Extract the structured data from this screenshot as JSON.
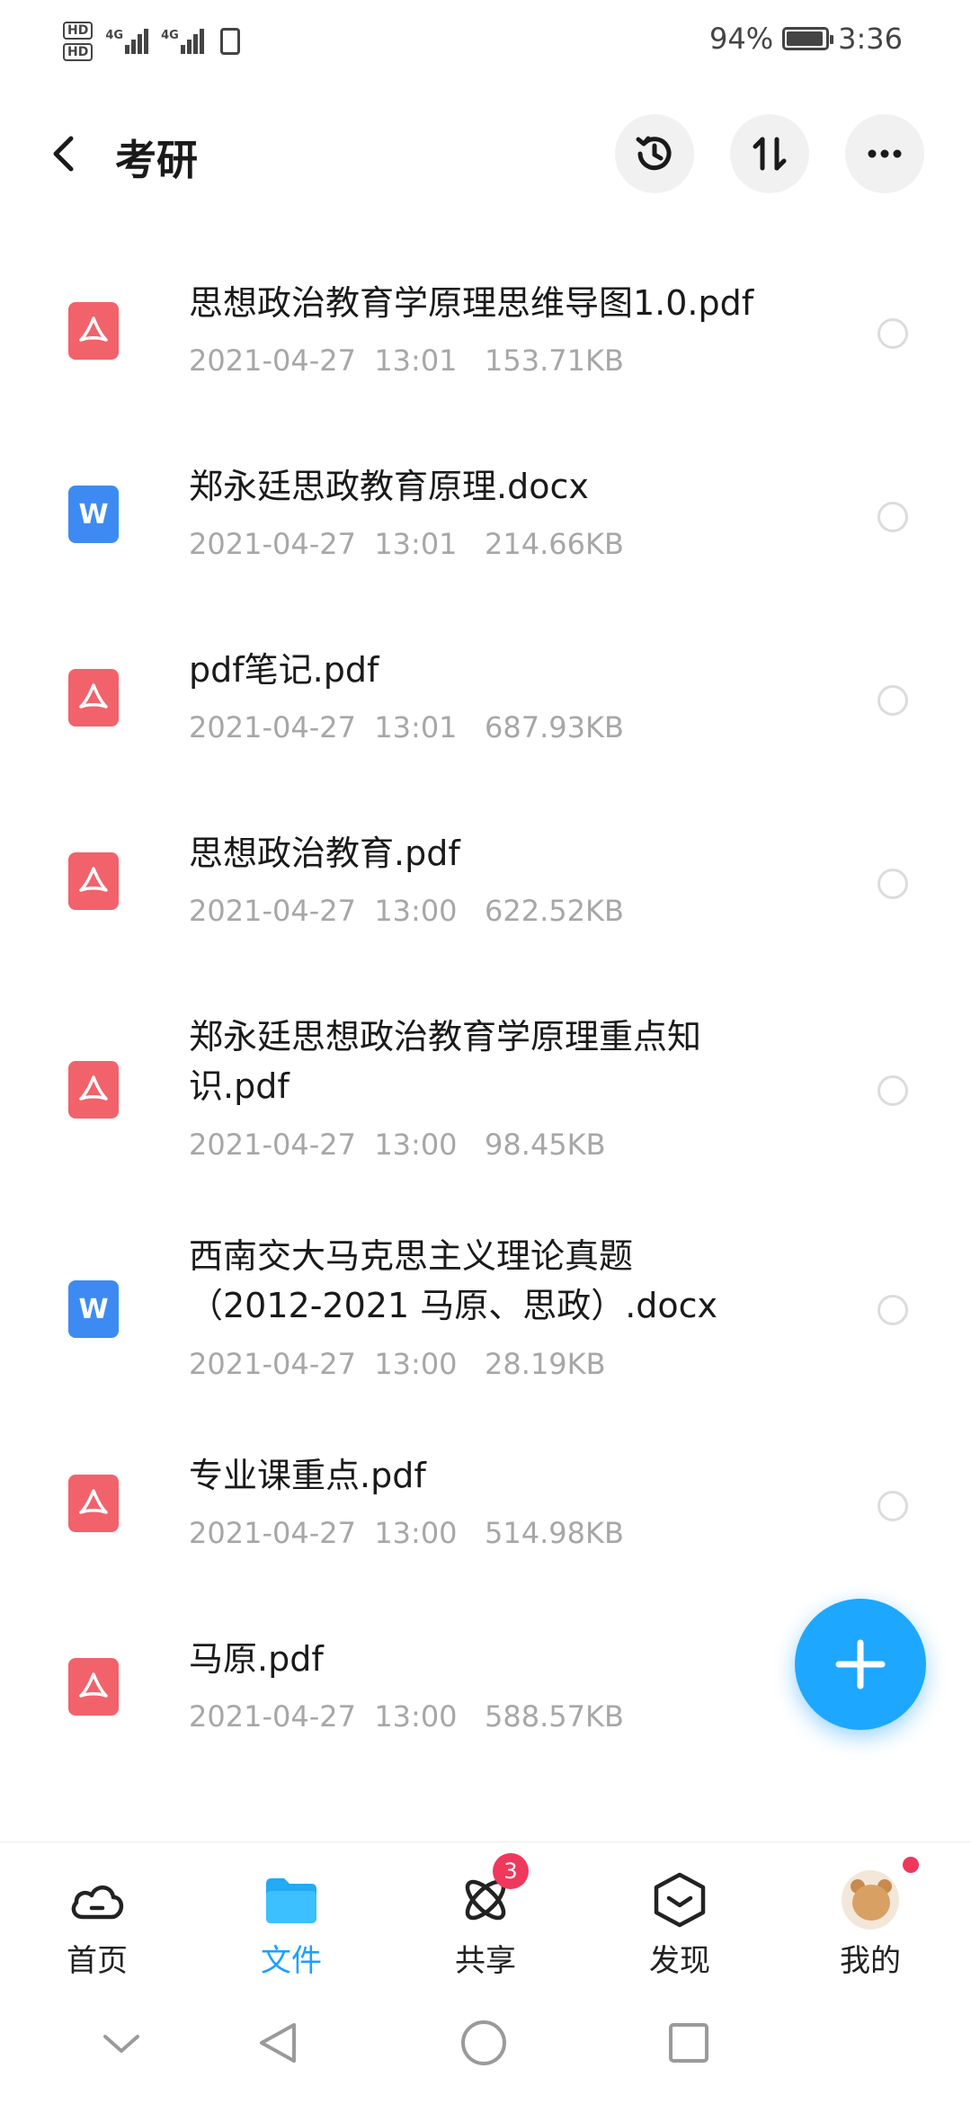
{
  "status_bar": {
    "hd1": "HD",
    "hd2": "HD",
    "net1": "4G",
    "net2": "4G",
    "battery_percent": "94%",
    "battery_level": 0.94,
    "time": "3:36"
  },
  "header": {
    "title": "考研",
    "back_icon": "chevron-left-icon",
    "history_icon": "history-icon",
    "sort_icon": "sort-icon",
    "more_icon": "more-icon"
  },
  "files": [
    {
      "name": "思想政治教育学原理思维导图1.0.pdf",
      "type": "pdf",
      "meta": "2021-04-27  13:01   153.71KB"
    },
    {
      "name": "郑永廷思政教育原理.docx",
      "type": "docx",
      "meta": "2021-04-27  13:01   214.66KB"
    },
    {
      "name": "pdf笔记.pdf",
      "type": "pdf",
      "meta": "2021-04-27  13:01   687.93KB"
    },
    {
      "name": "思想政治教育.pdf",
      "type": "pdf",
      "meta": "2021-04-27  13:00   622.52KB"
    },
    {
      "name": "郑永廷思想政治教育学原理重点知识.pdf",
      "type": "pdf",
      "meta": "2021-04-27  13:00   98.45KB"
    },
    {
      "name": "西南交大马克思主义理论真题（2012-2021 马原、思政）.docx",
      "type": "docx",
      "meta": "2021-04-27  13:00   28.19KB"
    },
    {
      "name": "专业课重点.pdf",
      "type": "pdf",
      "meta": "2021-04-27  13:00   514.98KB"
    },
    {
      "name": "马原.pdf",
      "type": "pdf",
      "meta": "2021-04-27  13:00   588.57KB"
    }
  ],
  "fab": {
    "icon": "plus-icon",
    "color": "#1ea7ff"
  },
  "bottom_nav": {
    "items": [
      {
        "label": "首页",
        "icon": "cloud-icon"
      },
      {
        "label": "文件",
        "icon": "folder-icon",
        "active": true
      },
      {
        "label": "共享",
        "icon": "share-orbit-icon",
        "badge": "3"
      },
      {
        "label": "发现",
        "icon": "discover-box-icon"
      },
      {
        "label": "我的",
        "icon": "avatar-icon",
        "dot": true
      }
    ]
  },
  "colors": {
    "accent": "#1ea0ff",
    "pdf": "#f2626b",
    "docx": "#3d8bf2",
    "badge": "#f0375c",
    "meta_text": "#a7a7a7"
  }
}
